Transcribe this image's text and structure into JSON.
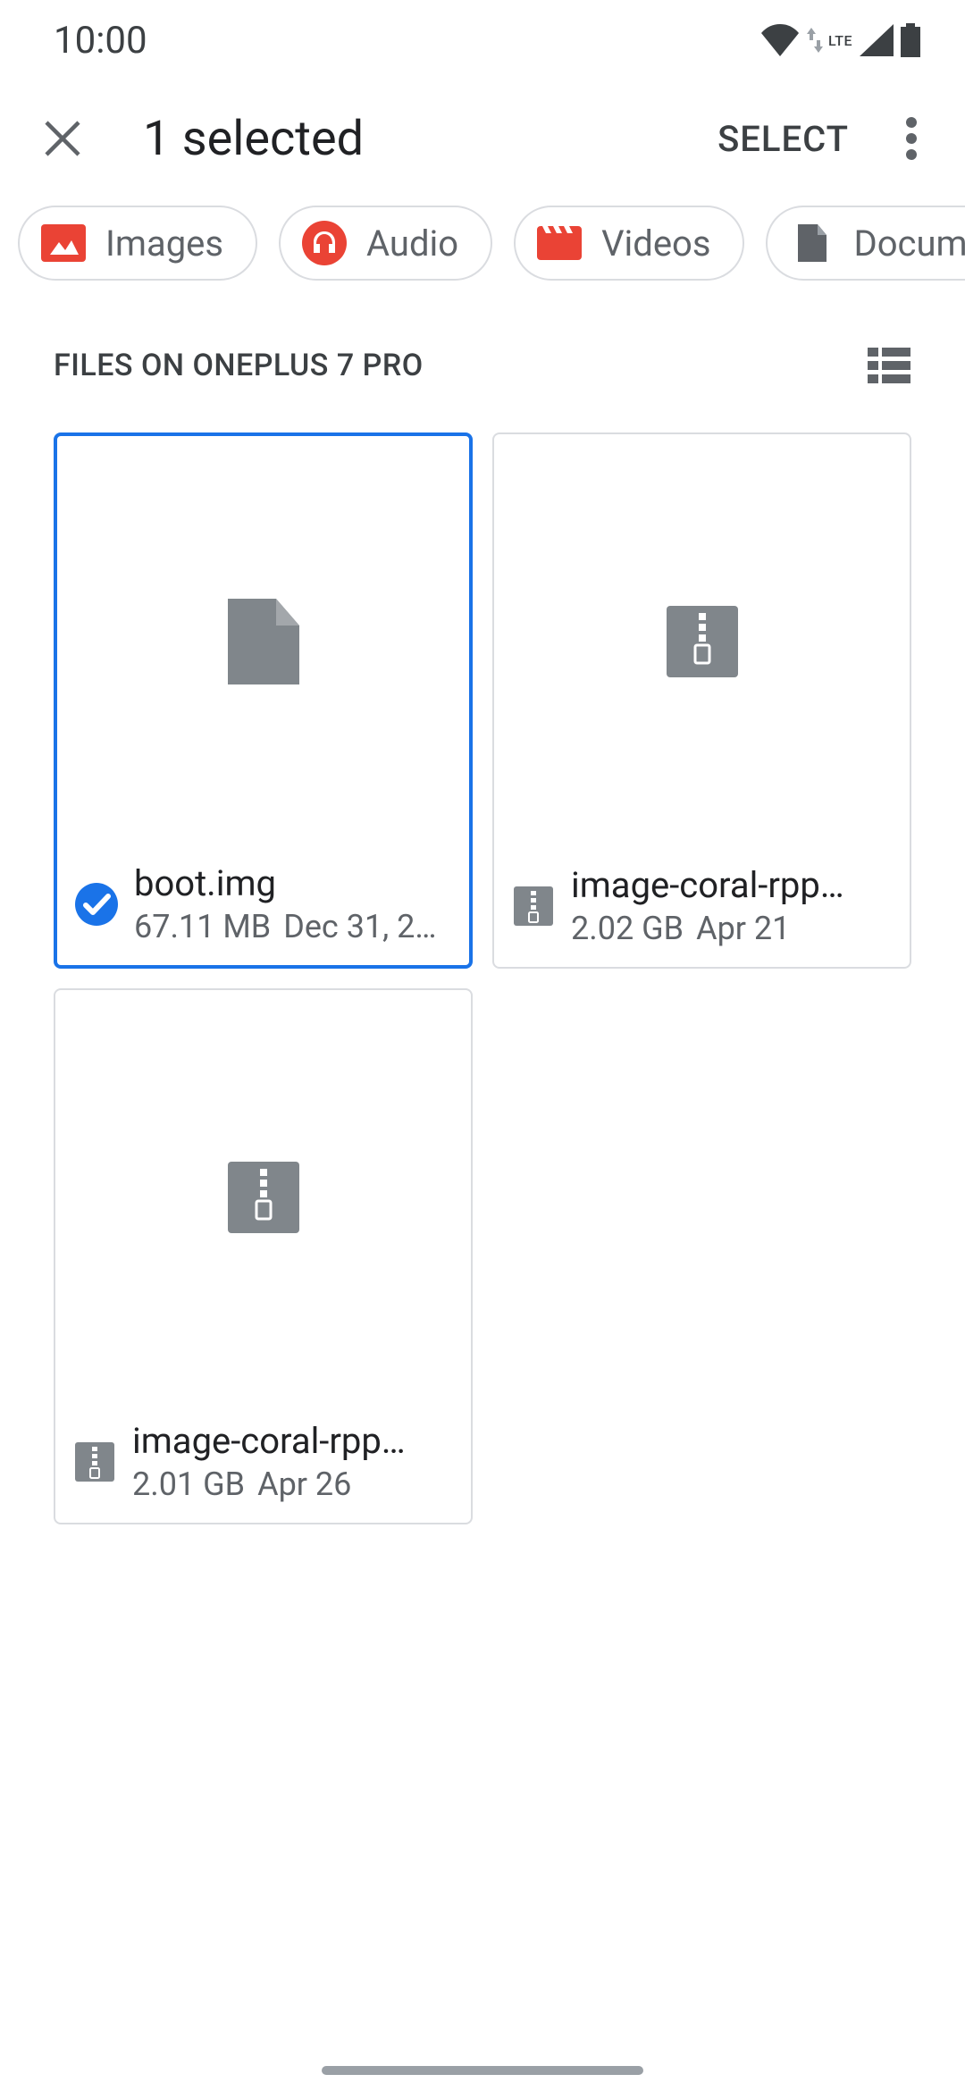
{
  "status": {
    "time": "10:00",
    "lte": "LTE"
  },
  "appbar": {
    "title": "1 selected",
    "select_label": "SELECT"
  },
  "chips": [
    {
      "icon": "images",
      "label": "Images"
    },
    {
      "icon": "audio",
      "label": "Audio"
    },
    {
      "icon": "videos",
      "label": "Videos"
    },
    {
      "icon": "documents",
      "label": "Documen"
    }
  ],
  "section": {
    "title": "FILES ON ONEPLUS 7 PRO"
  },
  "files": [
    {
      "name": "boot.img",
      "size": "67.11 MB",
      "date": "Dec 31, 2…",
      "type": "file",
      "selected": true
    },
    {
      "name": "image-coral-rpp…",
      "size": "2.02 GB",
      "date": "Apr 21",
      "type": "zip",
      "selected": false
    },
    {
      "name": "image-coral-rpp…",
      "size": "2.01 GB",
      "date": "Apr 26",
      "type": "zip",
      "selected": false
    }
  ]
}
